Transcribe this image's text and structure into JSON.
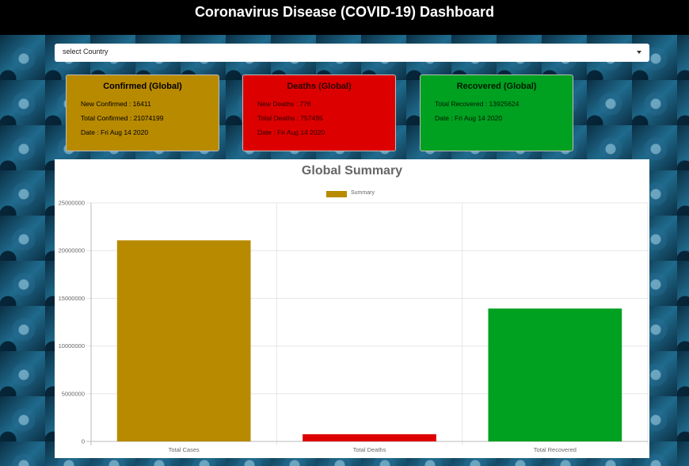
{
  "header": {
    "title": "Coronavirus Disease (COVID-19) Dashboard"
  },
  "country_select": {
    "value": "select Country"
  },
  "cards": {
    "confirmed": {
      "title": "Confirmed (Global)",
      "line1": "New Confirmed : 16411",
      "line2": "Total Confirmed : 21074199",
      "line3": "Date : Fri Aug 14 2020",
      "color": "#b88a00"
    },
    "deaths": {
      "title": "Deaths (Global)",
      "line1": "New Deaths : 776",
      "line2": "Total Deaths : 757495",
      "line3": "Date : Fri Aug 14 2020",
      "color": "#dd0000"
    },
    "recovered": {
      "title": "Recovered (Global)",
      "line1": "Total Recovered : 13925624",
      "line2": "Date : Fri Aug 14 2020",
      "color": "#00a020"
    }
  },
  "chart_data": {
    "type": "bar",
    "title": "Global Summary",
    "categories": [
      "Total Cases",
      "Total Deaths",
      "Total Recovered"
    ],
    "series": [
      {
        "name": "Summary",
        "values": [
          21074199,
          757495,
          13925624
        ]
      }
    ],
    "bar_colors": [
      "#b88a00",
      "#dd0000",
      "#00a020"
    ],
    "ylim": [
      0,
      25000000
    ],
    "yticks": [
      0,
      5000000,
      10000000,
      15000000,
      20000000,
      25000000
    ],
    "grid": true,
    "legend": "top-center",
    "xlabel": "",
    "ylabel": ""
  }
}
